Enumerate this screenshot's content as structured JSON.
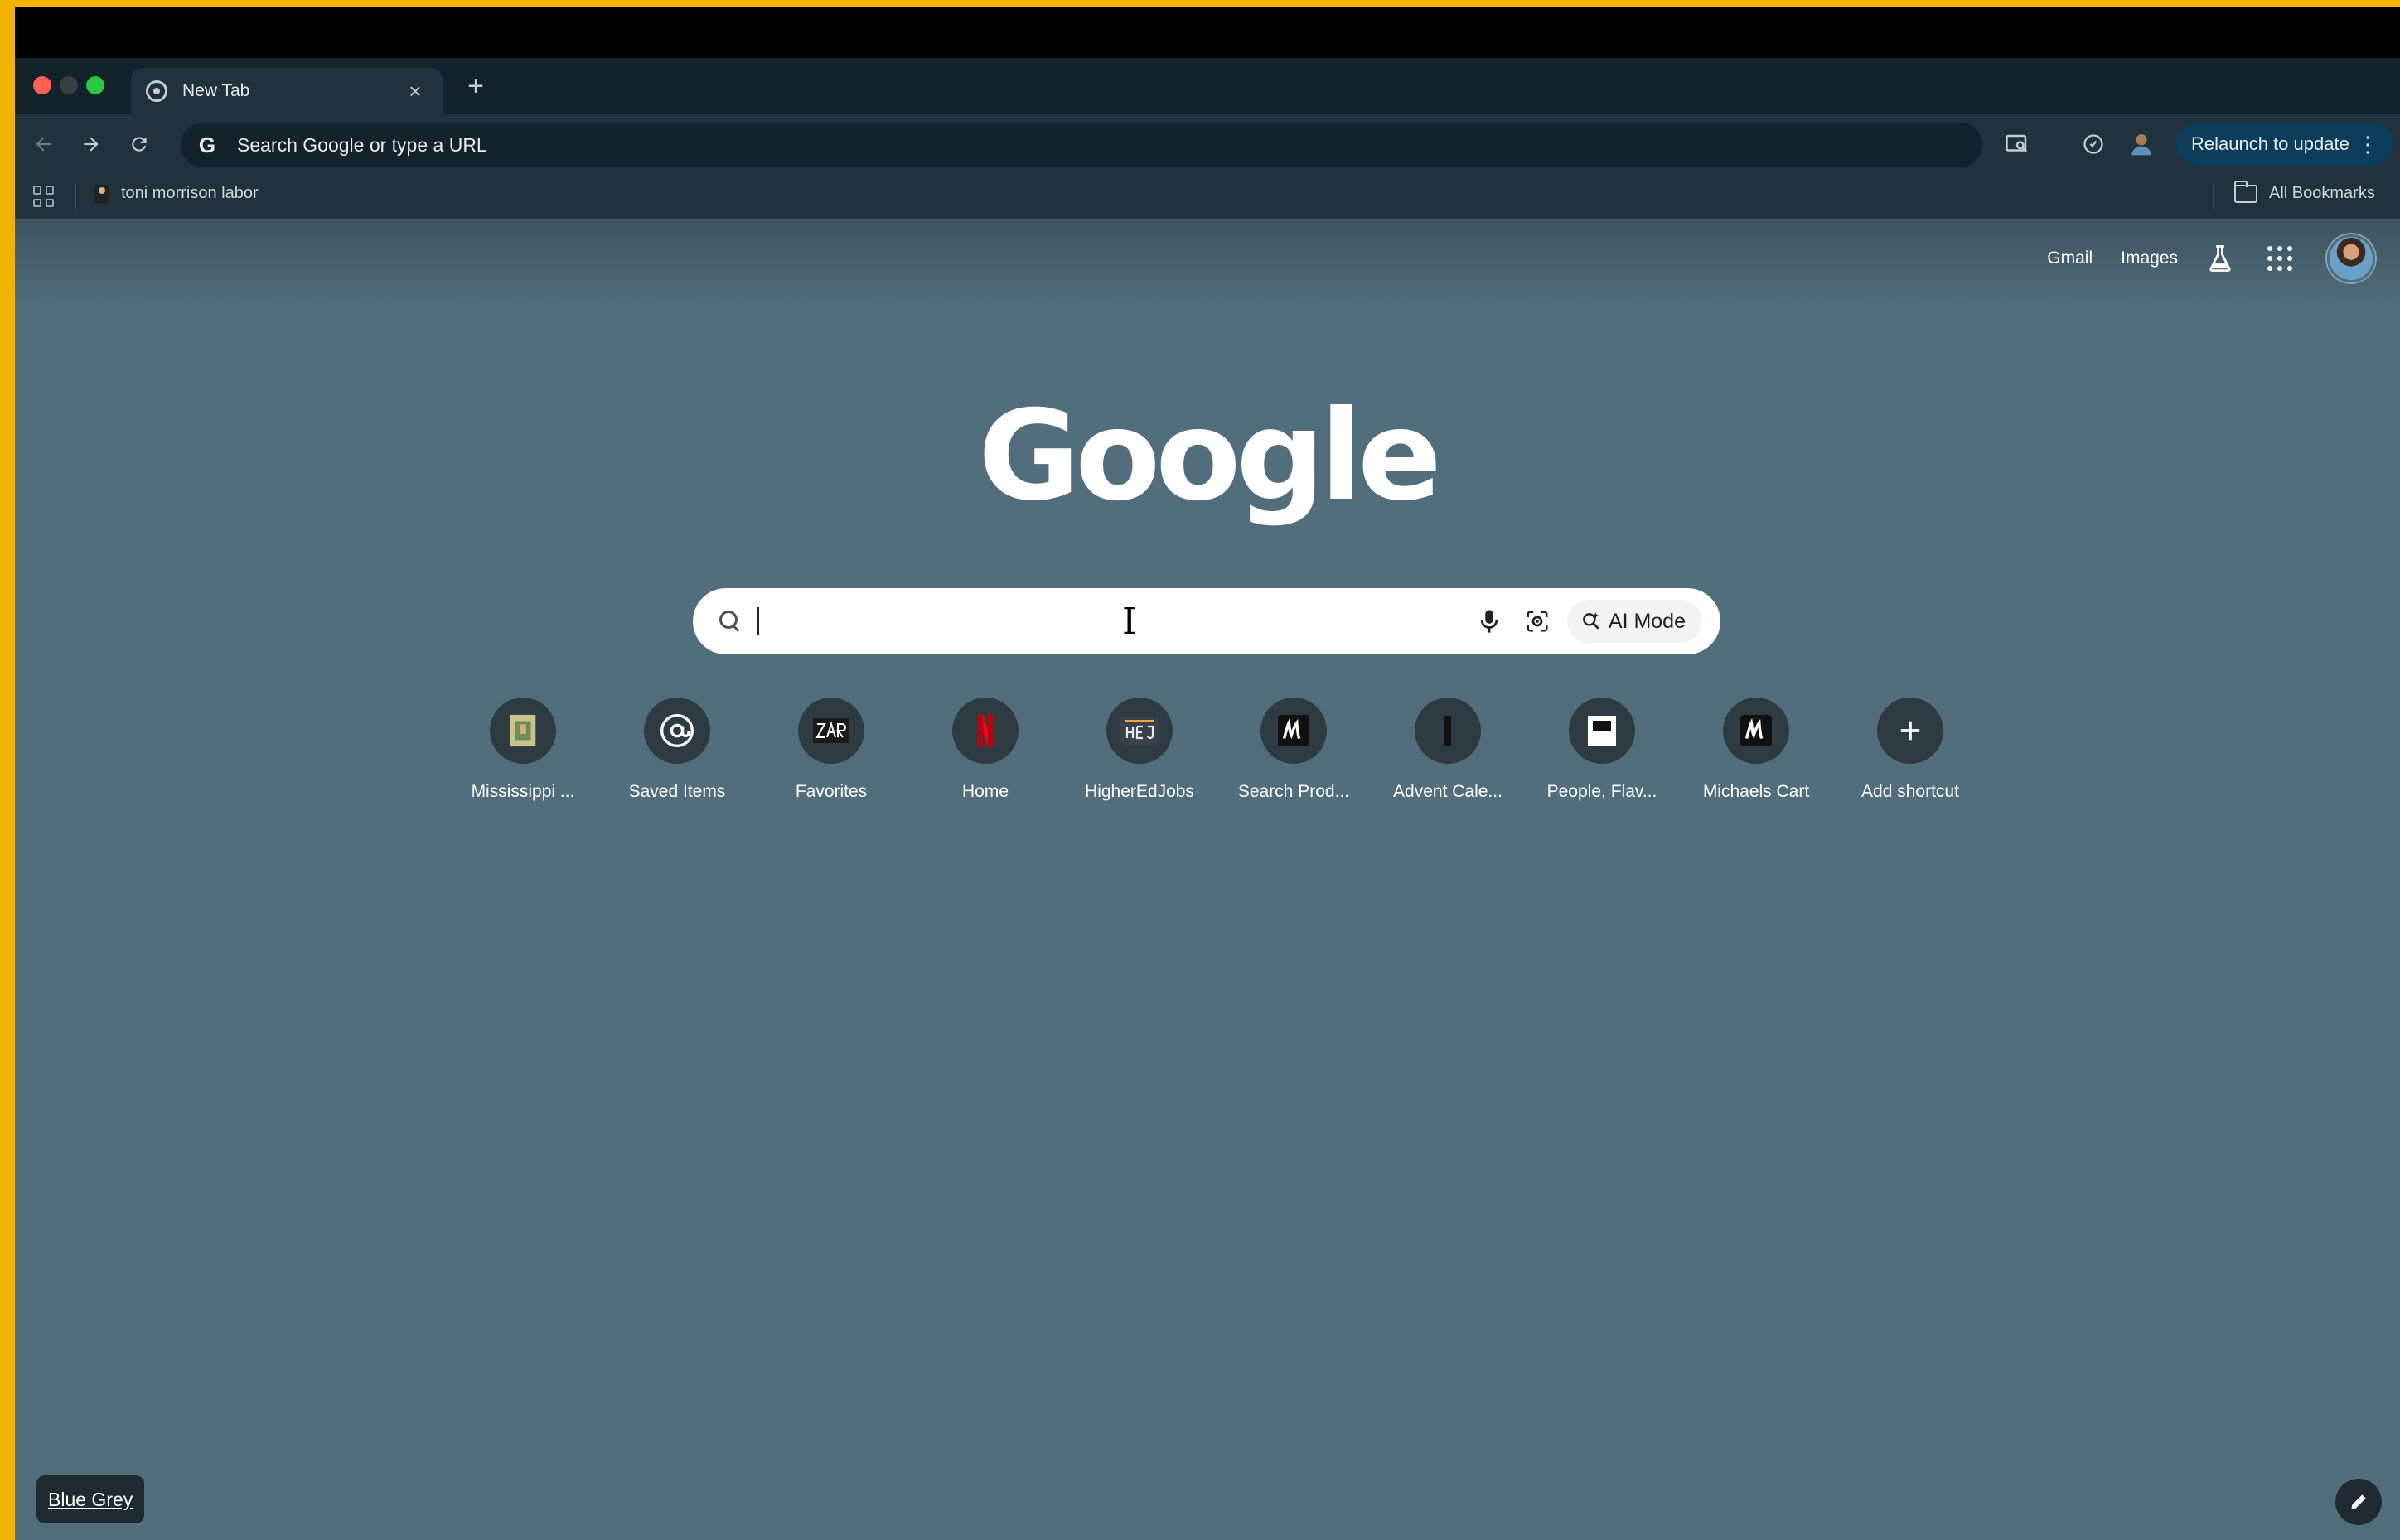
{
  "browser": {
    "tab": {
      "title": "New Tab",
      "close_icon": "×"
    },
    "new_tab_icon": "+",
    "omnibox": {
      "placeholder": "Search Google or type a URL",
      "engine_icon": "G"
    },
    "relaunch_label": "Relaunch to update",
    "relaunch_menu_icon": "⋮",
    "bookmarks": {
      "items": [
        {
          "label": "toni morrison labor"
        }
      ],
      "all_bookmarks_label": "All Bookmarks"
    }
  },
  "page": {
    "top_links": {
      "gmail": "Gmail",
      "images": "Images"
    },
    "logo_text": "Google",
    "search": {
      "placeholder": "",
      "ai_mode_label": "AI Mode"
    },
    "shortcuts": [
      {
        "label": "Mississippi ...",
        "icon": "book-cover-icon"
      },
      {
        "label": "Saved Items",
        "icon": "at-sign-icon"
      },
      {
        "label": "Favorites",
        "icon": "zara-logo-icon"
      },
      {
        "label": "Home",
        "icon": "netflix-logo-icon"
      },
      {
        "label": "HigherEdJobs",
        "icon": "hej-logo-icon"
      },
      {
        "label": "Search Prod...",
        "icon": "michaels-logo-icon"
      },
      {
        "label": "Advent Cale...",
        "icon": "bar-icon"
      },
      {
        "label": "People, Flav...",
        "icon": "bookmark-box-icon"
      },
      {
        "label": "Michaels Cart",
        "icon": "michaels-logo-icon"
      },
      {
        "label": "Add shortcut",
        "icon": "plus-icon"
      }
    ],
    "theme_chip_label": "Blue Grey"
  },
  "colors": {
    "page_background": "#526e7d",
    "toolbar": "#20323b",
    "relaunch_button": "#0c3d5a",
    "frame_border": "#f0b400"
  }
}
